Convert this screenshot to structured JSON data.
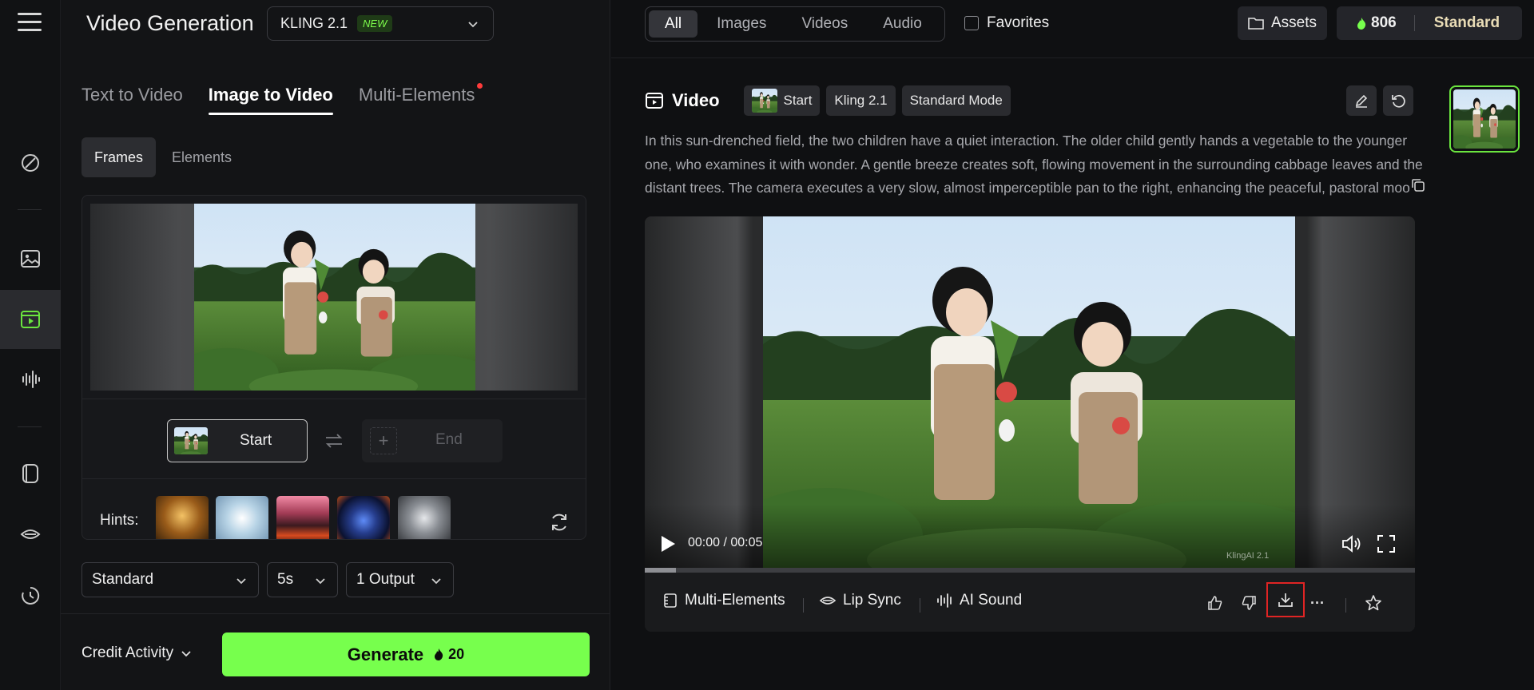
{
  "app": {
    "title": "Video Generation",
    "model": "KLING 2.1",
    "model_badge": "NEW"
  },
  "rail": {
    "items": [
      "magic-pen",
      "image",
      "video",
      "audio",
      "elements",
      "lip-sync",
      "history"
    ],
    "active": "video"
  },
  "modes": {
    "tabs": [
      {
        "label": "Text to Video",
        "active": false
      },
      {
        "label": "Image to Video",
        "active": true
      },
      {
        "label": "Multi-Elements",
        "active": false,
        "has_dot": true
      }
    ]
  },
  "subtabs": [
    {
      "label": "Frames",
      "active": true
    },
    {
      "label": "Elements",
      "active": false
    }
  ],
  "frames": {
    "start_label": "Start",
    "end_label": "End",
    "hints_label": "Hints:"
  },
  "settings": {
    "mode": "Standard",
    "duration": "5s",
    "outputs": "1 Output"
  },
  "footer": {
    "credit_activity": "Credit Activity",
    "generate_label": "Generate",
    "generate_cost": "20"
  },
  "filters": {
    "items": [
      {
        "label": "All",
        "active": true
      },
      {
        "label": "Images",
        "active": false
      },
      {
        "label": "Videos",
        "active": false
      },
      {
        "label": "Audio",
        "active": false
      }
    ],
    "favorites_label": "Favorites"
  },
  "account": {
    "assets_label": "Assets",
    "credits": "806",
    "plan": "Standard"
  },
  "result": {
    "title": "Video",
    "chips": [
      "Start",
      "Kling 2.1",
      "Standard Mode"
    ],
    "prompt": "In this sun-drenched field, the two children have a quiet interaction. The older child gently hands a vegetable to the younger one, who examines it with wonder. A gentle breeze creates soft, flowing movement in the surrounding cabbage leaves and the distant trees. The camera executes a very slow, almost imperceptible pan to the right, enhancing the peaceful, pastoral mood."
  },
  "player": {
    "time": "00:00 / 00:05",
    "watermark": "KlingAI 2.1",
    "progress_fraction": 0.04
  },
  "actions": {
    "multi_elements": "Multi-Elements",
    "lip_sync": "Lip Sync",
    "ai_sound": "AI Sound",
    "more": "···"
  },
  "colors": {
    "accent_green": "#77ff4d",
    "highlight_red": "#e02424",
    "plan_gold": "#e9dcb6"
  }
}
